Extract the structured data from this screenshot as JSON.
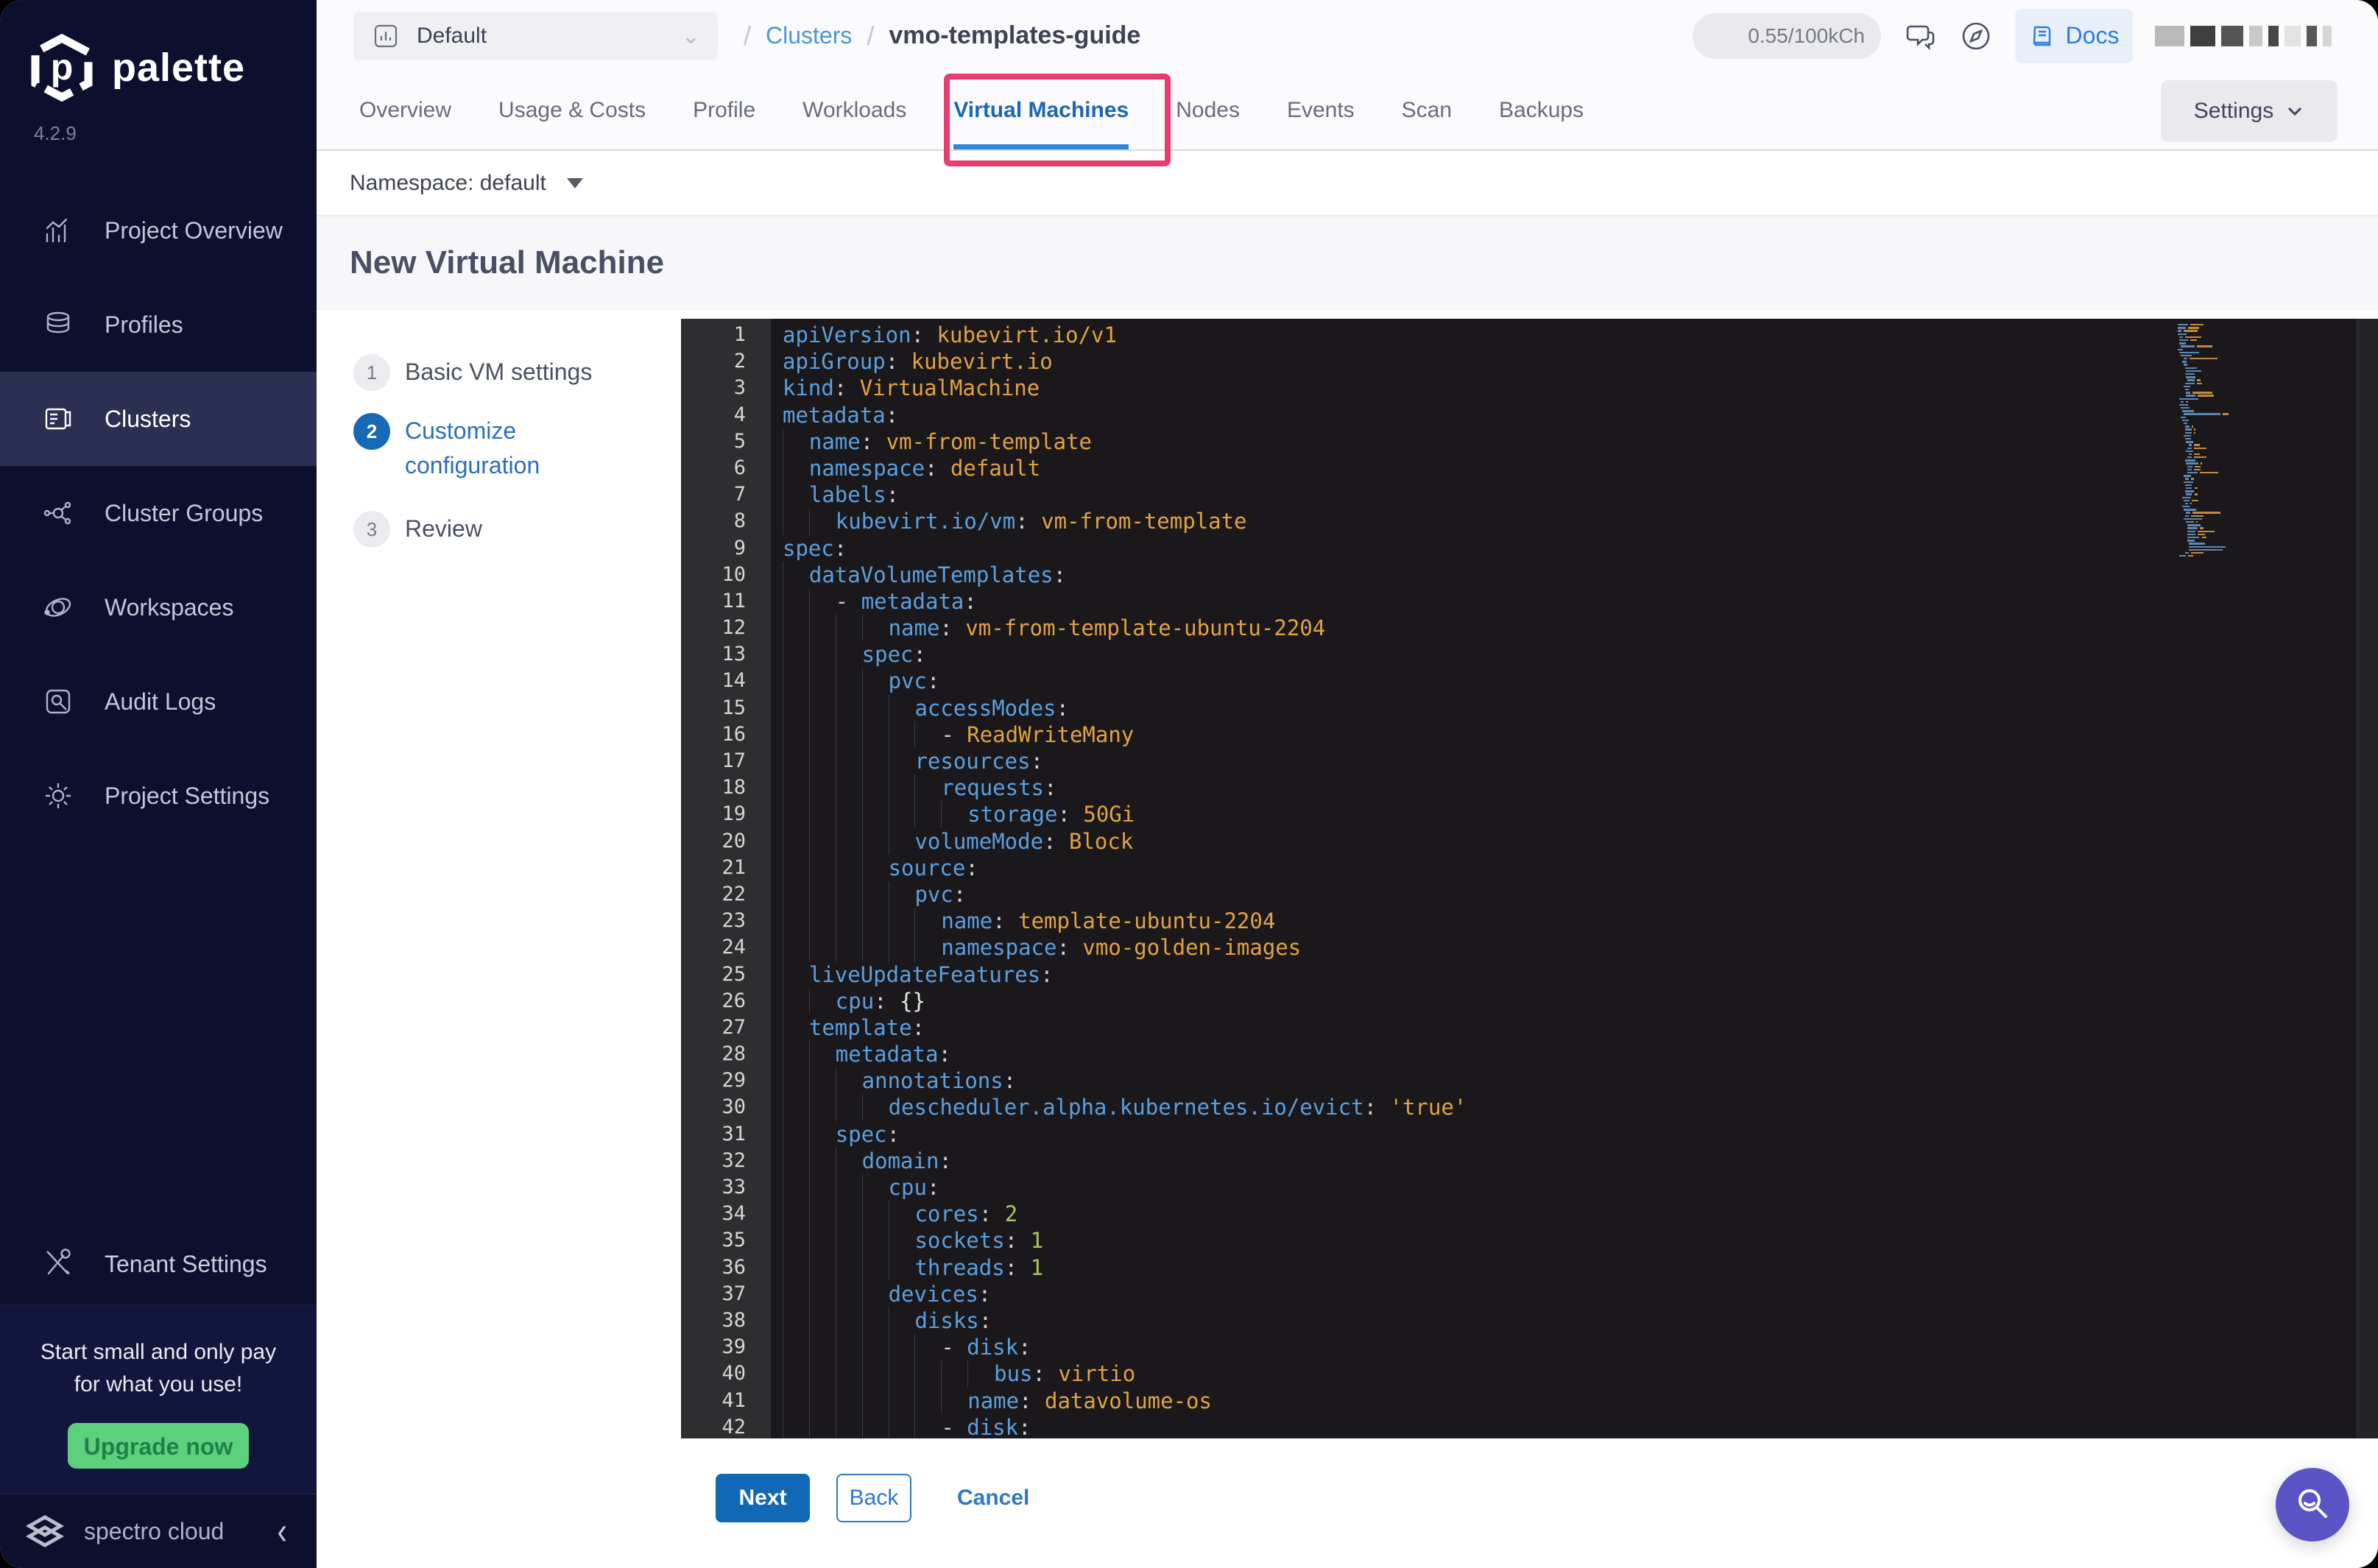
{
  "app": {
    "brand": "palette",
    "version": "4.2.9",
    "footer_brand": "spectro cloud"
  },
  "colors": {
    "sidebar_bg": "#0c0f2e",
    "active_item_bg": "#2b2f52",
    "accent_blue": "#1d66b4",
    "annotation_pink": "#e93b6e",
    "upgrade_green": "#5dd07e",
    "fab_purple": "#5b54c6",
    "editor_bg": "#1b181c",
    "code_key": "#5aa0df",
    "code_value": "#e2a33f",
    "code_number": "#abc45f"
  },
  "sidebar": {
    "active_index": 2,
    "items": [
      {
        "label": "Project Overview",
        "icon": "chart-icon"
      },
      {
        "label": "Profiles",
        "icon": "layers-icon"
      },
      {
        "label": "Clusters",
        "icon": "clusters-icon"
      },
      {
        "label": "Cluster Groups",
        "icon": "cluster-groups-icon"
      },
      {
        "label": "Workspaces",
        "icon": "workspaces-icon"
      },
      {
        "label": "Audit Logs",
        "icon": "audit-icon"
      },
      {
        "label": "Project Settings",
        "icon": "gear-icon"
      }
    ],
    "tenant": {
      "label": "Tenant Settings",
      "icon": "tools-icon"
    },
    "promo": {
      "line1": "Start small and only pay",
      "line2": "for what you use!",
      "button": "Upgrade now"
    }
  },
  "topbar": {
    "project": {
      "label": "Default"
    },
    "breadcrumb": {
      "sep": "/",
      "root": "Clusters",
      "current": "vmo-templates-guide"
    },
    "usage_pill": "0.55/100kCh",
    "docs_label": "Docs"
  },
  "tabs": {
    "items": [
      "Overview",
      "Usage & Costs",
      "Profile",
      "Workloads",
      "Virtual Machines",
      "Nodes",
      "Events",
      "Scan",
      "Backups"
    ],
    "active": "Virtual Machines",
    "settings_label": "Settings"
  },
  "annotation": {
    "target": "Virtual Machines"
  },
  "namespace_bar": {
    "label": "Namespace: default"
  },
  "page": {
    "title": "New Virtual Machine"
  },
  "stepper": [
    {
      "num": "1",
      "label": "Basic VM settings",
      "active": false
    },
    {
      "num": "2",
      "label": "Customize configuration",
      "active": true
    },
    {
      "num": "3",
      "label": "Review",
      "active": false
    }
  ],
  "editor": {
    "lines": [
      {
        "n": 1,
        "i": 0,
        "s": [
          [
            "k",
            "apiVersion"
          ],
          [
            "p",
            ": "
          ],
          [
            "v",
            "kubevirt.io/v1"
          ]
        ]
      },
      {
        "n": 2,
        "i": 0,
        "s": [
          [
            "k",
            "apiGroup"
          ],
          [
            "p",
            ": "
          ],
          [
            "v",
            "kubevirt.io"
          ]
        ]
      },
      {
        "n": 3,
        "i": 0,
        "s": [
          [
            "k",
            "kind"
          ],
          [
            "p",
            ": "
          ],
          [
            "v",
            "VirtualMachine"
          ]
        ]
      },
      {
        "n": 4,
        "i": 0,
        "s": [
          [
            "k",
            "metadata"
          ],
          [
            "p",
            ":"
          ]
        ]
      },
      {
        "n": 5,
        "i": 2,
        "s": [
          [
            "k",
            "name"
          ],
          [
            "p",
            ": "
          ],
          [
            "v",
            "vm-from-template"
          ]
        ]
      },
      {
        "n": 6,
        "i": 2,
        "s": [
          [
            "k",
            "namespace"
          ],
          [
            "p",
            ": "
          ],
          [
            "v",
            "default"
          ]
        ]
      },
      {
        "n": 7,
        "i": 2,
        "s": [
          [
            "k",
            "labels"
          ],
          [
            "p",
            ":"
          ]
        ]
      },
      {
        "n": 8,
        "i": 4,
        "s": [
          [
            "k",
            "kubevirt.io/vm"
          ],
          [
            "p",
            ": "
          ],
          [
            "v",
            "vm-from-template"
          ]
        ]
      },
      {
        "n": 9,
        "i": 0,
        "s": [
          [
            "k",
            "spec"
          ],
          [
            "p",
            ":"
          ]
        ]
      },
      {
        "n": 10,
        "i": 2,
        "s": [
          [
            "k",
            "dataVolumeTemplates"
          ],
          [
            "p",
            ":"
          ]
        ]
      },
      {
        "n": 11,
        "i": 4,
        "s": [
          [
            "d",
            "- "
          ],
          [
            "k",
            "metadata"
          ],
          [
            "p",
            ":"
          ]
        ]
      },
      {
        "n": 12,
        "i": 8,
        "s": [
          [
            "k",
            "name"
          ],
          [
            "p",
            ": "
          ],
          [
            "v",
            "vm-from-template-ubuntu-2204"
          ]
        ]
      },
      {
        "n": 13,
        "i": 6,
        "s": [
          [
            "k",
            "spec"
          ],
          [
            "p",
            ":"
          ]
        ]
      },
      {
        "n": 14,
        "i": 8,
        "s": [
          [
            "k",
            "pvc"
          ],
          [
            "p",
            ":"
          ]
        ]
      },
      {
        "n": 15,
        "i": 10,
        "s": [
          [
            "k",
            "accessModes"
          ],
          [
            "p",
            ":"
          ]
        ]
      },
      {
        "n": 16,
        "i": 12,
        "s": [
          [
            "d",
            "- "
          ],
          [
            "v",
            "ReadWriteMany"
          ]
        ]
      },
      {
        "n": 17,
        "i": 10,
        "s": [
          [
            "k",
            "resources"
          ],
          [
            "p",
            ":"
          ]
        ]
      },
      {
        "n": 18,
        "i": 12,
        "s": [
          [
            "k",
            "requests"
          ],
          [
            "p",
            ":"
          ]
        ]
      },
      {
        "n": 19,
        "i": 14,
        "s": [
          [
            "k",
            "storage"
          ],
          [
            "p",
            ": "
          ],
          [
            "v",
            "50Gi"
          ]
        ]
      },
      {
        "n": 20,
        "i": 10,
        "s": [
          [
            "k",
            "volumeMode"
          ],
          [
            "p",
            ": "
          ],
          [
            "v",
            "Block"
          ]
        ]
      },
      {
        "n": 21,
        "i": 8,
        "s": [
          [
            "k",
            "source"
          ],
          [
            "p",
            ":"
          ]
        ]
      },
      {
        "n": 22,
        "i": 10,
        "s": [
          [
            "k",
            "pvc"
          ],
          [
            "p",
            ":"
          ]
        ]
      },
      {
        "n": 23,
        "i": 12,
        "s": [
          [
            "k",
            "name"
          ],
          [
            "p",
            ": "
          ],
          [
            "v",
            "template-ubuntu-2204"
          ]
        ]
      },
      {
        "n": 24,
        "i": 12,
        "s": [
          [
            "k",
            "namespace"
          ],
          [
            "p",
            ": "
          ],
          [
            "v",
            "vmo-golden-images"
          ]
        ]
      },
      {
        "n": 25,
        "i": 2,
        "s": [
          [
            "k",
            "liveUpdateFeatures"
          ],
          [
            "p",
            ":"
          ]
        ]
      },
      {
        "n": 26,
        "i": 4,
        "s": [
          [
            "k",
            "cpu"
          ],
          [
            "p",
            ": "
          ],
          [
            "b",
            "{}"
          ]
        ]
      },
      {
        "n": 27,
        "i": 2,
        "s": [
          [
            "k",
            "template"
          ],
          [
            "p",
            ":"
          ]
        ]
      },
      {
        "n": 28,
        "i": 4,
        "s": [
          [
            "k",
            "metadata"
          ],
          [
            "p",
            ":"
          ]
        ]
      },
      {
        "n": 29,
        "i": 6,
        "s": [
          [
            "k",
            "annotations"
          ],
          [
            "p",
            ":"
          ]
        ]
      },
      {
        "n": 30,
        "i": 8,
        "s": [
          [
            "k",
            "descheduler.alpha.kubernetes.io/evict"
          ],
          [
            "p",
            ": "
          ],
          [
            "v",
            "'true'"
          ]
        ]
      },
      {
        "n": 31,
        "i": 4,
        "s": [
          [
            "k",
            "spec"
          ],
          [
            "p",
            ":"
          ]
        ]
      },
      {
        "n": 32,
        "i": 6,
        "s": [
          [
            "k",
            "domain"
          ],
          [
            "p",
            ":"
          ]
        ]
      },
      {
        "n": 33,
        "i": 8,
        "s": [
          [
            "k",
            "cpu"
          ],
          [
            "p",
            ":"
          ]
        ]
      },
      {
        "n": 34,
        "i": 10,
        "s": [
          [
            "k",
            "cores"
          ],
          [
            "p",
            ": "
          ],
          [
            "n2",
            "2"
          ]
        ]
      },
      {
        "n": 35,
        "i": 10,
        "s": [
          [
            "k",
            "sockets"
          ],
          [
            "p",
            ": "
          ],
          [
            "n2",
            "1"
          ]
        ]
      },
      {
        "n": 36,
        "i": 10,
        "s": [
          [
            "k",
            "threads"
          ],
          [
            "p",
            ": "
          ],
          [
            "n2",
            "1"
          ]
        ]
      },
      {
        "n": 37,
        "i": 8,
        "s": [
          [
            "k",
            "devices"
          ],
          [
            "p",
            ":"
          ]
        ]
      },
      {
        "n": 38,
        "i": 10,
        "s": [
          [
            "k",
            "disks"
          ],
          [
            "p",
            ":"
          ]
        ]
      },
      {
        "n": 39,
        "i": 12,
        "s": [
          [
            "d",
            "- "
          ],
          [
            "k",
            "disk"
          ],
          [
            "p",
            ":"
          ]
        ]
      },
      {
        "n": 40,
        "i": 16,
        "s": [
          [
            "k",
            "bus"
          ],
          [
            "p",
            ": "
          ],
          [
            "v",
            "virtio"
          ]
        ]
      },
      {
        "n": 41,
        "i": 14,
        "s": [
          [
            "k",
            "name"
          ],
          [
            "p",
            ": "
          ],
          [
            "v",
            "datavolume-os"
          ]
        ]
      },
      {
        "n": 42,
        "i": 12,
        "s": [
          [
            "d",
            "- "
          ],
          [
            "k",
            "disk"
          ],
          [
            "p",
            ":"
          ]
        ]
      }
    ],
    "minimap_continuation": [
      {
        "i": 16,
        "t": "bus: virtio"
      },
      {
        "i": 14,
        "t": "name: cloudinitdisk"
      },
      {
        "i": 10,
        "t": "interfaces:"
      },
      {
        "i": 12,
        "t": "- masquerade: {}"
      },
      {
        "i": 14,
        "t": "model: virtio"
      },
      {
        "i": 14,
        "t": "name: default"
      },
      {
        "i": 14,
        "t": "macAddress: '02:C9:02:1B:8D:5A'"
      },
      {
        "i": 8,
        "t": "machine:"
      },
      {
        "i": 10,
        "t": "type: q35"
      },
      {
        "i": 8,
        "t": "resources:"
      },
      {
        "i": 10,
        "t": "limits:"
      },
      {
        "i": 12,
        "t": "memory: 2Gi"
      },
      {
        "i": 10,
        "t": "requests:"
      },
      {
        "i": 12,
        "t": "memory: 2Gi"
      },
      {
        "i": 6,
        "t": "networks:"
      },
      {
        "i": 8,
        "t": "- name: default"
      },
      {
        "i": 10,
        "t": "pod: {}"
      },
      {
        "i": 6,
        "t": "volumes:"
      },
      {
        "i": 8,
        "t": "- dataVolume:"
      },
      {
        "i": 12,
        "t": "name: vm-from-template-ubuntu-2204"
      },
      {
        "i": 10,
        "t": "name: datavolume-os"
      },
      {
        "i": 8,
        "t": "- cloudInitNoCloud:"
      },
      {
        "i": 12,
        "t": "userData: |"
      },
      {
        "i": 14,
        "t": "#cloud-config"
      },
      {
        "i": 14,
        "t": "ssh_pwauth: true"
      },
      {
        "i": 14,
        "t": "chpasswd: { expire: false }"
      },
      {
        "i": 14,
        "t": "password: spectro"
      },
      {
        "i": 14,
        "t": "disable_root: false"
      },
      {
        "i": 14,
        "t": "runcmd:"
      },
      {
        "i": 16,
        "t": "- apt-get update"
      },
      {
        "i": 16,
        "t": "- apt-get install -y qemu-guest-agent"
      },
      {
        "i": 16,
        "t": "- systemctl start qemu-guest-agent"
      },
      {
        "i": 10,
        "t": "name: cloudinitdisk"
      },
      {
        "i": 2,
        "t": "running: false"
      }
    ]
  },
  "footer": {
    "next": "Next",
    "back": "Back",
    "cancel": "Cancel"
  },
  "redacted_blocks": [
    "#b9b9b9",
    "#3f3f3f",
    "#555555",
    "#c9c9c9",
    "#474747",
    "#e3e3e3",
    "#595959",
    "#d5d5d5"
  ]
}
